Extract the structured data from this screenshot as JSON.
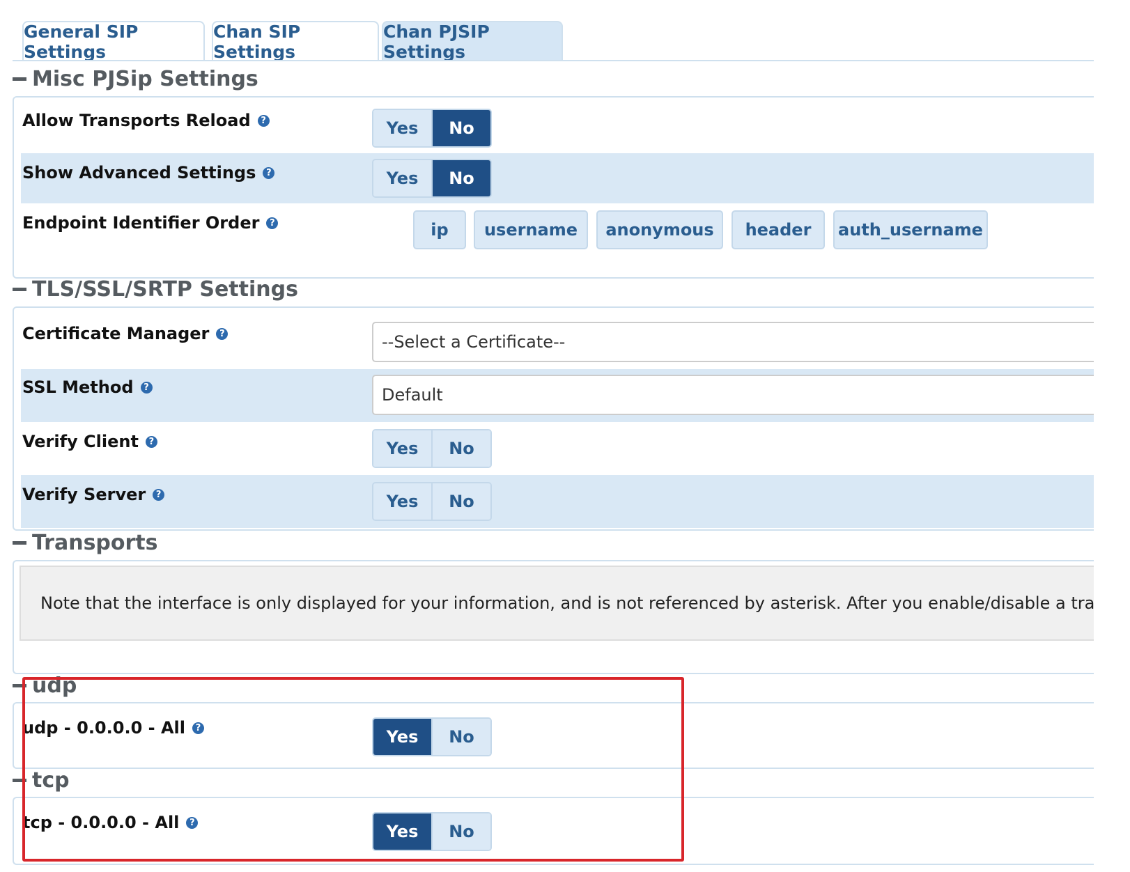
{
  "tabs": [
    {
      "label": "General SIP Settings"
    },
    {
      "label": "Chan SIP Settings"
    },
    {
      "label": "Chan PJSIP Settings"
    }
  ],
  "sections": {
    "misc": {
      "title": "Misc PJSip Settings",
      "allow_transports_reload": {
        "label": "Allow Transports Reload",
        "yes": "Yes",
        "no": "No",
        "selected": "No"
      },
      "show_advanced_settings": {
        "label": "Show Advanced Settings",
        "yes": "Yes",
        "no": "No",
        "selected": "No"
      },
      "endpoint_identifier_order": {
        "label": "Endpoint Identifier Order",
        "items": [
          "ip",
          "username",
          "anonymous",
          "header",
          "auth_username"
        ]
      }
    },
    "tls": {
      "title": "TLS/SSL/SRTP Settings",
      "certificate_manager": {
        "label": "Certificate Manager",
        "value": "--Select a Certificate--"
      },
      "ssl_method": {
        "label": "SSL Method",
        "value": "Default"
      },
      "verify_client": {
        "label": "Verify Client",
        "yes": "Yes",
        "no": "No",
        "selected": "none"
      },
      "verify_server": {
        "label": "Verify Server",
        "yes": "Yes",
        "no": "No",
        "selected": "none"
      }
    },
    "transports": {
      "title": "Transports",
      "note": "Note that the interface is only displayed for your information, and is not referenced by asterisk. After you enable/disable a transport, asterisk needs to be"
    },
    "udp": {
      "title": "udp",
      "row": {
        "label": "udp - 0.0.0.0 - All",
        "yes": "Yes",
        "no": "No",
        "selected": "Yes"
      }
    },
    "tcp": {
      "title": "tcp",
      "row": {
        "label": "tcp - 0.0.0.0 - All",
        "yes": "Yes",
        "no": "No",
        "selected": "Yes"
      }
    }
  },
  "help_glyph": "?",
  "colors": {
    "accent": "#1f4f86",
    "tab_text": "#2a5d8f",
    "row_alt": "#d9e8f5",
    "highlight": "#d8262b"
  }
}
